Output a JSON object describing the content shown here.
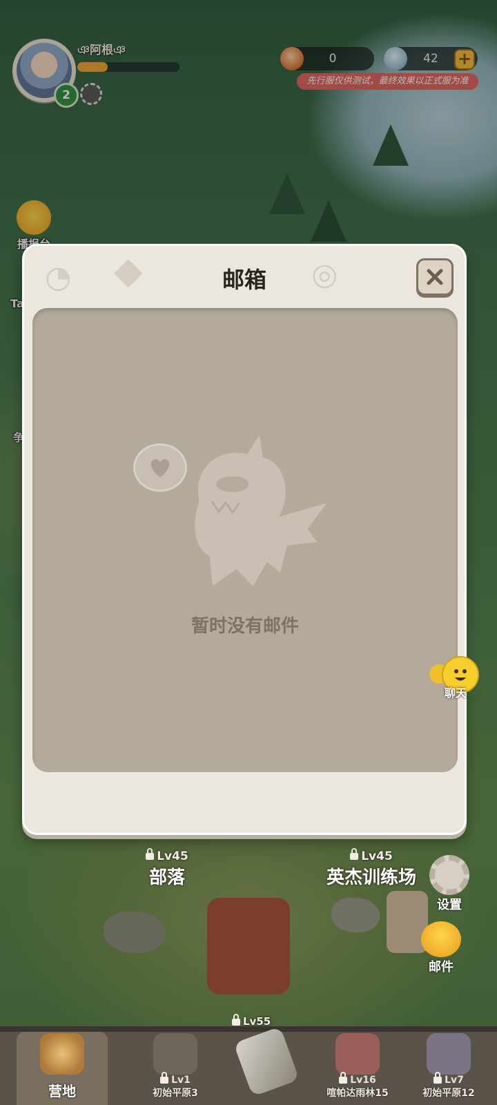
{
  "player": {
    "name": "ঞ阿根ঞ",
    "level": "2",
    "xp_fraction": 0.3
  },
  "currency": {
    "coins": "0",
    "gems": "42",
    "add": "+"
  },
  "banner": "先行服仅供测试，最终效果以正式服为准",
  "side_left": [
    {
      "label": "播报台",
      "icon": "megaphone-bird-icon"
    },
    {
      "label": "Ta",
      "icon": "task-icon"
    },
    {
      "label": "争",
      "icon": "battle-icon"
    }
  ],
  "modal": {
    "title": "邮箱",
    "empty_text": "暂时没有邮件",
    "close_icon": "close-icon"
  },
  "chat": {
    "label": "聊天",
    "icon": "chat-face-icon"
  },
  "map": {
    "tribe": {
      "lv": "Lv45",
      "name": "部落"
    },
    "training": {
      "lv": "Lv45",
      "name": "英杰训练场"
    },
    "center_lv": "Lv55"
  },
  "right_buttons": {
    "settings": "设置",
    "mail": "邮件"
  },
  "nav": {
    "camp": "营地",
    "items": [
      {
        "lv": "Lv1",
        "name": "初始平原3"
      },
      {
        "lv": "Lv16",
        "name": "喧帕达雨林15"
      },
      {
        "lv": "Lv7",
        "name": "初始平原12"
      }
    ]
  },
  "colors": {
    "modal_bg": "#ebe7df",
    "panel_bg": "#b4aa9c",
    "banner": "#e0625c",
    "plus": "#f5b93a"
  }
}
